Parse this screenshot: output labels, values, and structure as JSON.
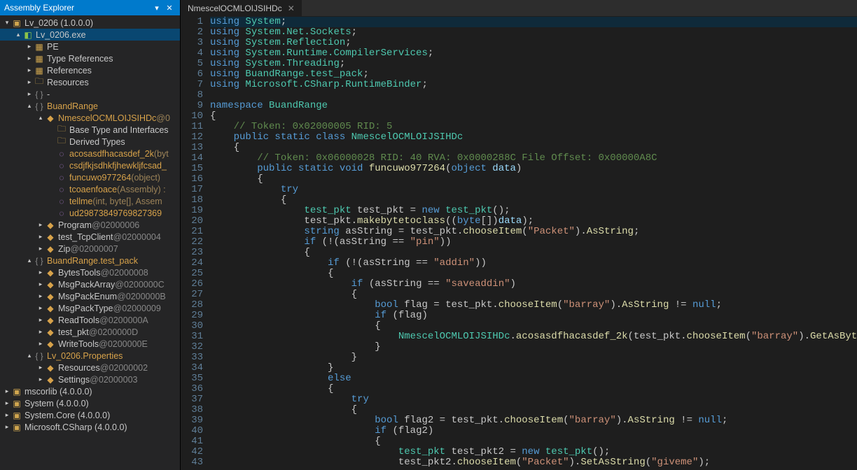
{
  "panel": {
    "title": "Assembly Explorer",
    "pin_icon": "▾",
    "close_icon": "✕"
  },
  "tree": [
    {
      "d": 0,
      "tw": "▾",
      "ic": "i-asm",
      "g": "▣",
      "t": "Lv_0206 (1.0.0.0)"
    },
    {
      "d": 1,
      "tw": "▴",
      "ic": "i-mod",
      "g": "◧",
      "t": "Lv_0206.exe",
      "sel": true
    },
    {
      "d": 2,
      "tw": "▸",
      "ic": "i-fold",
      "g": "▦",
      "t": "PE"
    },
    {
      "d": 2,
      "tw": "▸",
      "ic": "i-fold",
      "g": "▦",
      "t": "Type References"
    },
    {
      "d": 2,
      "tw": "▸",
      "ic": "i-fold",
      "g": "▦",
      "t": "References"
    },
    {
      "d": 2,
      "tw": "▸",
      "ic": "i-fold",
      "g": "🗀",
      "t": "Resources"
    },
    {
      "d": 2,
      "tw": "▸",
      "ic": "i-ns",
      "g": "{ }",
      "t": "-"
    },
    {
      "d": 2,
      "tw": "▴",
      "ic": "i-ns",
      "g": "{ }",
      "t": "BuandRange",
      "cls": "orange"
    },
    {
      "d": 3,
      "tw": "▴",
      "ic": "i-cls",
      "g": "◆",
      "t": "NmescelOCMLOIJSIHDc",
      "suf": " @0",
      "cls": "orange"
    },
    {
      "d": 4,
      "tw": "",
      "ic": "i-fold",
      "g": "🗀",
      "t": "Base Type and Interfaces"
    },
    {
      "d": 4,
      "tw": "",
      "ic": "i-fold",
      "g": "🗀",
      "t": "Derived Types"
    },
    {
      "d": 4,
      "tw": "",
      "ic": "i-met",
      "g": "◌",
      "t": "acosasdfhacasdef_2k",
      "suf": "(byt",
      "cls": "orange"
    },
    {
      "d": 4,
      "tw": "",
      "ic": "i-met",
      "g": "◌",
      "t": "csdjfkjsdhkfjhewkljfcsad_",
      "cls": "orange"
    },
    {
      "d": 4,
      "tw": "",
      "ic": "i-met",
      "g": "◌",
      "t": "funcuwo977264",
      "suf": "(object)",
      "cls": "orange"
    },
    {
      "d": 4,
      "tw": "",
      "ic": "i-met",
      "g": "◌",
      "t": "tcoaenfoace",
      "suf": "(Assembly) :",
      "cls": "orange"
    },
    {
      "d": 4,
      "tw": "",
      "ic": "i-met",
      "g": "◌",
      "t": "tellme",
      "suf": "(int, byte[], Assem",
      "cls": "orange"
    },
    {
      "d": 4,
      "tw": "",
      "ic": "i-met",
      "g": "◌",
      "t": "ud29873849769827369",
      "cls": "orange"
    },
    {
      "d": 3,
      "tw": "▸",
      "ic": "i-cls",
      "g": "◆",
      "t": "Program",
      "suf": " @02000006"
    },
    {
      "d": 3,
      "tw": "▸",
      "ic": "i-cls",
      "g": "◆",
      "t": "test_TcpClient",
      "suf": " @02000004"
    },
    {
      "d": 3,
      "tw": "▸",
      "ic": "i-cls",
      "g": "◆",
      "t": "Zip",
      "suf": " @02000007"
    },
    {
      "d": 2,
      "tw": "▴",
      "ic": "i-ns",
      "g": "{ }",
      "t": "BuandRange.test_pack",
      "cls": "orange"
    },
    {
      "d": 3,
      "tw": "▸",
      "ic": "i-cls",
      "g": "◆",
      "t": "BytesTools",
      "suf": " @02000008"
    },
    {
      "d": 3,
      "tw": "▸",
      "ic": "i-cls",
      "g": "◆",
      "t": "MsgPackArray",
      "suf": " @0200000C"
    },
    {
      "d": 3,
      "tw": "▸",
      "ic": "i-cls",
      "g": "◆",
      "t": "MsgPackEnum",
      "suf": " @0200000B"
    },
    {
      "d": 3,
      "tw": "▸",
      "ic": "i-cls",
      "g": "◆",
      "t": "MsgPackType",
      "suf": " @02000009"
    },
    {
      "d": 3,
      "tw": "▸",
      "ic": "i-cls",
      "g": "◆",
      "t": "ReadTools",
      "suf": " @0200000A"
    },
    {
      "d": 3,
      "tw": "▸",
      "ic": "i-cls",
      "g": "◆",
      "t": "test_pkt",
      "suf": " @0200000D"
    },
    {
      "d": 3,
      "tw": "▸",
      "ic": "i-cls",
      "g": "◆",
      "t": "WriteTools",
      "suf": " @0200000E"
    },
    {
      "d": 2,
      "tw": "▴",
      "ic": "i-ns",
      "g": "{ }",
      "t": "Lv_0206.Properties",
      "cls": "orange"
    },
    {
      "d": 3,
      "tw": "▸",
      "ic": "i-cls",
      "g": "◆",
      "t": "Resources",
      "suf": " @02000002"
    },
    {
      "d": 3,
      "tw": "▸",
      "ic": "i-cls",
      "g": "◆",
      "t": "Settings",
      "suf": " @02000003"
    },
    {
      "d": 0,
      "tw": "▸",
      "ic": "i-asm",
      "g": "▣",
      "t": "mscorlib (4.0.0.0)"
    },
    {
      "d": 0,
      "tw": "▸",
      "ic": "i-asm",
      "g": "▣",
      "t": "System (4.0.0.0)"
    },
    {
      "d": 0,
      "tw": "▸",
      "ic": "i-asm",
      "g": "▣",
      "t": "System.Core (4.0.0.0)"
    },
    {
      "d": 0,
      "tw": "▸",
      "ic": "i-asm",
      "g": "▣",
      "t": "Microsoft.CSharp (4.0.0.0)"
    }
  ],
  "tab": {
    "name": "NmescelOCMLOIJSIHDc",
    "close": "✕"
  },
  "code": [
    {
      "n": 1,
      "hl": true,
      "seg": [
        [
          "kw",
          "using "
        ],
        [
          "tp",
          "System"
        ],
        [
          "pn",
          ";"
        ]
      ]
    },
    {
      "n": 2,
      "seg": [
        [
          "kw",
          "using "
        ],
        [
          "tp",
          "System.Net.Sockets"
        ],
        [
          "pn",
          ";"
        ]
      ]
    },
    {
      "n": 3,
      "seg": [
        [
          "kw",
          "using "
        ],
        [
          "tp",
          "System.Reflection"
        ],
        [
          "pn",
          ";"
        ]
      ]
    },
    {
      "n": 4,
      "seg": [
        [
          "kw",
          "using "
        ],
        [
          "tp",
          "System.Runtime.CompilerServices"
        ],
        [
          "pn",
          ";"
        ]
      ]
    },
    {
      "n": 5,
      "seg": [
        [
          "kw",
          "using "
        ],
        [
          "tp",
          "System.Threading"
        ],
        [
          "pn",
          ";"
        ]
      ]
    },
    {
      "n": 6,
      "seg": [
        [
          "kw",
          "using "
        ],
        [
          "tp",
          "BuandRange.test_pack"
        ],
        [
          "pn",
          ";"
        ]
      ]
    },
    {
      "n": 7,
      "seg": [
        [
          "kw",
          "using "
        ],
        [
          "tp",
          "Microsoft.CSharp.RuntimeBinder"
        ],
        [
          "pn",
          ";"
        ]
      ]
    },
    {
      "n": 8,
      "seg": []
    },
    {
      "n": 9,
      "seg": [
        [
          "kw",
          "namespace "
        ],
        [
          "nsname",
          "BuandRange"
        ]
      ]
    },
    {
      "n": 10,
      "seg": [
        [
          "pn",
          "{"
        ]
      ]
    },
    {
      "n": 11,
      "seg": [
        [
          "pn",
          "    "
        ],
        [
          "cm",
          "// Token: 0x02000005 RID: 5"
        ]
      ]
    },
    {
      "n": 12,
      "seg": [
        [
          "pn",
          "    "
        ],
        [
          "kw",
          "public static class "
        ],
        [
          "tp",
          "NmescelOCMLOIJSIHDc"
        ]
      ]
    },
    {
      "n": 13,
      "seg": [
        [
          "pn",
          "    {"
        ]
      ]
    },
    {
      "n": 14,
      "seg": [
        [
          "pn",
          "        "
        ],
        [
          "cm",
          "// Token: 0x06000028 RID: 40 RVA: 0x0000288C File Offset: 0x00000A8C"
        ]
      ]
    },
    {
      "n": 15,
      "seg": [
        [
          "pn",
          "        "
        ],
        [
          "kw",
          "public static void "
        ],
        [
          "fn",
          "funcuwo977264"
        ],
        [
          "pn",
          "("
        ],
        [
          "kw",
          "object "
        ],
        [
          "prm",
          "data"
        ],
        [
          "pn",
          ")"
        ]
      ]
    },
    {
      "n": 16,
      "seg": [
        [
          "pn",
          "        {"
        ]
      ]
    },
    {
      "n": 17,
      "seg": [
        [
          "pn",
          "            "
        ],
        [
          "kw",
          "try"
        ]
      ]
    },
    {
      "n": 18,
      "seg": [
        [
          "pn",
          "            {"
        ]
      ]
    },
    {
      "n": 19,
      "seg": [
        [
          "pn",
          "                "
        ],
        [
          "tp",
          "test_pkt"
        ],
        [
          "pn",
          " test_pkt = "
        ],
        [
          "kw",
          "new "
        ],
        [
          "tp",
          "test_pkt"
        ],
        [
          "pn",
          "();"
        ]
      ]
    },
    {
      "n": 20,
      "seg": [
        [
          "pn",
          "                test_pkt."
        ],
        [
          "fn",
          "makebytetoclass"
        ],
        [
          "pn",
          "(("
        ],
        [
          "kw",
          "byte"
        ],
        [
          "pn",
          "[])"
        ],
        [
          "prm",
          "data"
        ],
        [
          "pn",
          ");"
        ]
      ]
    },
    {
      "n": 21,
      "seg": [
        [
          "pn",
          "                "
        ],
        [
          "kw",
          "string"
        ],
        [
          "pn",
          " asString = test_pkt."
        ],
        [
          "fn",
          "chooseItem"
        ],
        [
          "pn",
          "("
        ],
        [
          "st",
          "\"Packet\""
        ],
        [
          "pn",
          ")."
        ],
        [
          "member",
          "AsString"
        ],
        [
          "pn",
          ";"
        ]
      ]
    },
    {
      "n": 22,
      "seg": [
        [
          "pn",
          "                "
        ],
        [
          "kw",
          "if"
        ],
        [
          "pn",
          " (!(asString == "
        ],
        [
          "st",
          "\"pin\""
        ],
        [
          "pn",
          "))"
        ]
      ]
    },
    {
      "n": 23,
      "seg": [
        [
          "pn",
          "                {"
        ]
      ]
    },
    {
      "n": 24,
      "seg": [
        [
          "pn",
          "                    "
        ],
        [
          "kw",
          "if"
        ],
        [
          "pn",
          " (!(asString == "
        ],
        [
          "st",
          "\"addin\""
        ],
        [
          "pn",
          "))"
        ]
      ]
    },
    {
      "n": 25,
      "seg": [
        [
          "pn",
          "                    {"
        ]
      ]
    },
    {
      "n": 26,
      "seg": [
        [
          "pn",
          "                        "
        ],
        [
          "kw",
          "if"
        ],
        [
          "pn",
          " (asString == "
        ],
        [
          "st",
          "\"saveaddin\""
        ],
        [
          "pn",
          ")"
        ]
      ]
    },
    {
      "n": 27,
      "seg": [
        [
          "pn",
          "                        {"
        ]
      ]
    },
    {
      "n": 28,
      "seg": [
        [
          "pn",
          "                            "
        ],
        [
          "kw",
          "bool"
        ],
        [
          "pn",
          " flag = test_pkt."
        ],
        [
          "fn",
          "chooseItem"
        ],
        [
          "pn",
          "("
        ],
        [
          "st",
          "\"barray\""
        ],
        [
          "pn",
          ")."
        ],
        [
          "member",
          "AsString"
        ],
        [
          "pn",
          " != "
        ],
        [
          "kw",
          "null"
        ],
        [
          "pn",
          ";"
        ]
      ]
    },
    {
      "n": 29,
      "seg": [
        [
          "pn",
          "                            "
        ],
        [
          "kw",
          "if"
        ],
        [
          "pn",
          " (flag)"
        ]
      ]
    },
    {
      "n": 30,
      "seg": [
        [
          "pn",
          "                            {"
        ]
      ]
    },
    {
      "n": 31,
      "seg": [
        [
          "pn",
          "                                "
        ],
        [
          "tp",
          "NmescelOCMLOIJSIHDc"
        ],
        [
          "pn",
          "."
        ],
        [
          "fn",
          "acosasdfhacasdef_2k"
        ],
        [
          "pn",
          "(test_pkt."
        ],
        [
          "fn",
          "chooseItem"
        ],
        [
          "pn",
          "("
        ],
        [
          "st",
          "\"barray\""
        ],
        [
          "pn",
          ")."
        ],
        [
          "fn",
          "GetAsBytes"
        ],
        [
          "pn",
          "());"
        ]
      ]
    },
    {
      "n": 32,
      "seg": [
        [
          "pn",
          "                            }"
        ]
      ]
    },
    {
      "n": 33,
      "seg": [
        [
          "pn",
          "                        }"
        ]
      ]
    },
    {
      "n": 34,
      "seg": [
        [
          "pn",
          "                    }"
        ]
      ]
    },
    {
      "n": 35,
      "seg": [
        [
          "pn",
          "                    "
        ],
        [
          "kw",
          "else"
        ]
      ]
    },
    {
      "n": 36,
      "seg": [
        [
          "pn",
          "                    {"
        ]
      ]
    },
    {
      "n": 37,
      "seg": [
        [
          "pn",
          "                        "
        ],
        [
          "kw",
          "try"
        ]
      ]
    },
    {
      "n": 38,
      "seg": [
        [
          "pn",
          "                        {"
        ]
      ]
    },
    {
      "n": 39,
      "seg": [
        [
          "pn",
          "                            "
        ],
        [
          "kw",
          "bool"
        ],
        [
          "pn",
          " flag2 = test_pkt."
        ],
        [
          "fn",
          "chooseItem"
        ],
        [
          "pn",
          "("
        ],
        [
          "st",
          "\"barray\""
        ],
        [
          "pn",
          ")."
        ],
        [
          "member",
          "AsString"
        ],
        [
          "pn",
          " != "
        ],
        [
          "kw",
          "null"
        ],
        [
          "pn",
          ";"
        ]
      ]
    },
    {
      "n": 40,
      "seg": [
        [
          "pn",
          "                            "
        ],
        [
          "kw",
          "if"
        ],
        [
          "pn",
          " (flag2)"
        ]
      ]
    },
    {
      "n": 41,
      "seg": [
        [
          "pn",
          "                            {"
        ]
      ]
    },
    {
      "n": 42,
      "seg": [
        [
          "pn",
          "                                "
        ],
        [
          "tp",
          "test_pkt"
        ],
        [
          "pn",
          " test_pkt2 = "
        ],
        [
          "kw",
          "new "
        ],
        [
          "tp",
          "test_pkt"
        ],
        [
          "pn",
          "();"
        ]
      ]
    },
    {
      "n": 43,
      "seg": [
        [
          "pn",
          "                                test_pkt2."
        ],
        [
          "fn",
          "chooseItem"
        ],
        [
          "pn",
          "("
        ],
        [
          "st",
          "\"Packet\""
        ],
        [
          "pn",
          ")."
        ],
        [
          "fn",
          "SetAsString"
        ],
        [
          "pn",
          "("
        ],
        [
          "st",
          "\"giveme\""
        ],
        [
          "pn",
          ");"
        ]
      ]
    }
  ]
}
